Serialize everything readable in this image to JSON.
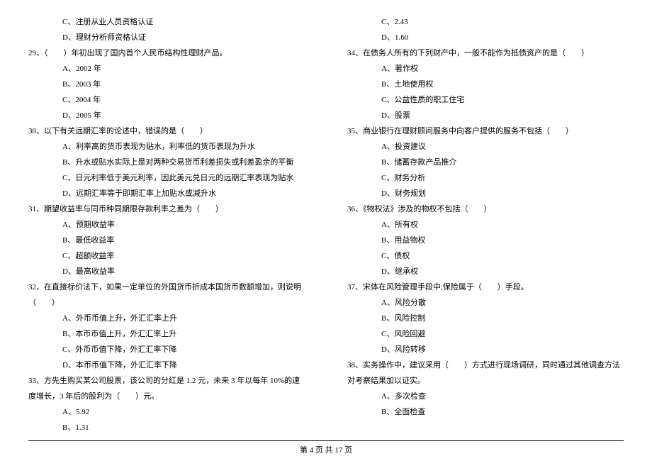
{
  "left": {
    "q28c": "C、注册从业人员资格认证",
    "q28d": "D、理财分析师资格认证",
    "q29": "29、（　　）年初出现了国内首个人民币结构性理财产品。",
    "q29a": "A、2002 年",
    "q29b": "B、2003 年",
    "q29c": "C、2004 年",
    "q29d": "D、2005 年",
    "q30": "30、以下有关远期汇率的论述中，错误的是（　　）",
    "q30a": "A、利率高的货币表现为贴水，利率低的货币表现为升水",
    "q30b": "B、升水或贴水实际上是对两种交易货币利差损失或利差盈余的平衡",
    "q30c": "C、日元利率低于美元利率，因此美元兑日元的远期汇率表现为贴水",
    "q30d": "D、远期汇率等于即期汇率上加贴水或减升水",
    "q31": "31、期望收益率与同币种同期限存款利率之差为（　　）",
    "q31a": "A、预期收益率",
    "q31b": "B、最低收益率",
    "q31c": "C、超额收益率",
    "q31d": "D、最高收益率",
    "q32": "32、在直接标价法下，如果一定单位的外国货币折成本国货币数额增加，则说明（　　）",
    "q32a": "A、外币币值上升，外汇汇率上升",
    "q32b": "B、本币币值上升，外汇汇率上升",
    "q32c": "C、外币币值下降，外汇汇率下降",
    "q32d": "D、本币币值下降，外汇汇率下降",
    "q33": "33、方先生购买某公司股票，该公司的分红是 1.2 元，未来 3 年以每年 10%的速度增长，3 年后的股利为（　　）元。",
    "q33a": "A、5.92",
    "q33b": "B、1.31"
  },
  "right": {
    "q33c": "C、2.43",
    "q33d": "D、1.60",
    "q34": "34、在债务人所有的下列财产中，一般不能作为抵债资产的是（　　）",
    "q34a": "A、著作权",
    "q34b": "B、土地使用权",
    "q34c": "C、公益性质的职工住宅",
    "q34d": "D、股票",
    "q35": "35、商业银行在理财顾问服务中向客户提供的服务不包括（　　）",
    "q35a": "A、投资建议",
    "q35b": "B、储蓄存款产品推介",
    "q35c": "C、财务分析",
    "q35d": "D、财务规划",
    "q36": "36、《物权法》涉及的物权不包括（　　）",
    "q36a": "A、所有权",
    "q36b": "B、用益物权",
    "q36c": "C、债权",
    "q36d": "D、继承权",
    "q37": "37、宋体在风险管理手段中,保险属于（　　）手段。",
    "q37a": "A、风险分散",
    "q37b": "B、风险控制",
    "q37c": "C、风险回避",
    "q37d": "D、风险转移",
    "q38": "38、实务操作中，建议采用（　　）方式进行现场调研，同时通过其他调查方法对考察结果加以证实。",
    "q38a": "A、多次检查",
    "q38b": "B、全面检查"
  },
  "footer": "第 4 页 共 17 页"
}
